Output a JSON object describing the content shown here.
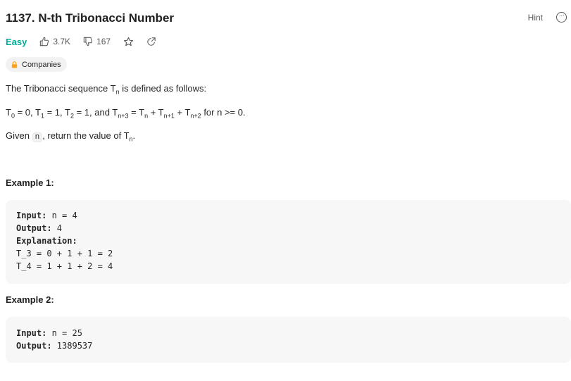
{
  "problem": {
    "title": "1137. N-th Tribonacci Number",
    "difficulty": "Easy",
    "likes": "3.7K",
    "dislikes": "167",
    "companies_label": "Companies"
  },
  "header": {
    "hint_label": "Hint"
  },
  "description": {
    "line1": {
      "text1": "The Tribonacci sequence T",
      "sub1": "n",
      "text2": " is defined as follows:"
    },
    "line2": {
      "p1": "T",
      "s1": "0",
      "p2": " = 0, T",
      "s2": "1",
      "p3": " = 1, T",
      "s3": "2",
      "p4": " = 1, and T",
      "s4": "n+3",
      "p5": " = T",
      "s5": "n",
      "p6": " + T",
      "s6": "n+1",
      "p7": " + T",
      "s7": "n+2",
      "p8": " for n >= 0."
    },
    "line3": {
      "text1": "Given ",
      "code": "n",
      "text2": ", return the value of T",
      "sub": "n",
      "text3": "."
    }
  },
  "examples": [
    {
      "title": "Example 1:",
      "input_label": "Input:",
      "input_value": " n = 4",
      "output_label": "Output:",
      "output_value": " 4",
      "explanation_label": "Explanation:",
      "explanation_lines": [
        "T_3 = 0 + 1 + 1 = 2",
        "T_4 = 1 + 1 + 2 = 4"
      ]
    },
    {
      "title": "Example 2:",
      "input_label": "Input:",
      "input_value": " n = 25",
      "output_label": "Output:",
      "output_value": " 1389537"
    }
  ],
  "colors": {
    "difficulty_easy": "#00af9b",
    "code_background": "#f7f7f8",
    "chip_background": "#f2f2f2",
    "lock_icon": "#ffa116"
  }
}
